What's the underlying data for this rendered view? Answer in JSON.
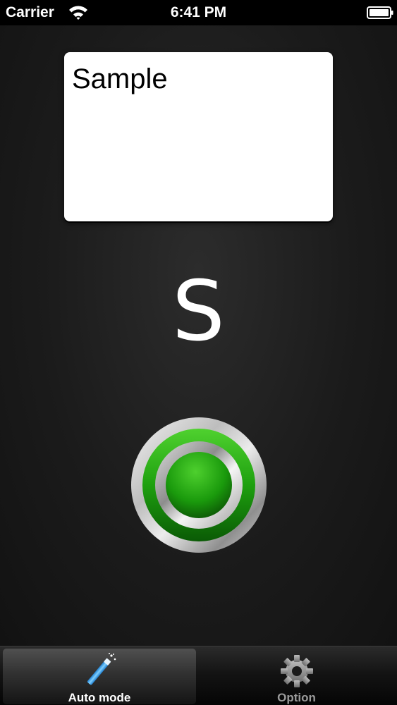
{
  "status_bar": {
    "carrier": "Carrier",
    "time": "6:41 PM",
    "wifi_icon": "wifi-icon",
    "battery_icon": "battery-full-icon"
  },
  "main": {
    "card_text": "Sample",
    "letter": "S",
    "record_button_icon": "record-button-icon",
    "record_button_color": "#1faa12"
  },
  "tab_bar": {
    "tabs": [
      {
        "label": "Auto mode",
        "icon": "magic-wand-icon",
        "selected": true
      },
      {
        "label": "Option",
        "icon": "gear-icon",
        "selected": false
      }
    ]
  },
  "colors": {
    "background": "#1b1b1b",
    "card": "#ffffff",
    "accent_blue": "#3aa8f0",
    "green": "#1faa12"
  }
}
